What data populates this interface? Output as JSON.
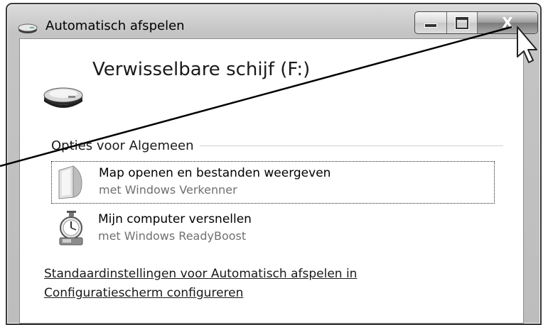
{
  "window": {
    "title": "Automatisch afspelen",
    "close_label": "X"
  },
  "device": {
    "title": "Verwisselbare schijf (F:)"
  },
  "section": {
    "header": "Opties voor Algemeen"
  },
  "options": [
    {
      "label": "Map openen en bestanden weergeven",
      "sub": "met Windows Verkenner",
      "icon": "folder-icon",
      "selected": true
    },
    {
      "label": "Mijn computer versnellen",
      "sub": "met Windows ReadyBoost",
      "icon": "stopwatch-icon",
      "selected": false
    }
  ],
  "footer": {
    "link_line1": "Standaardinstellingen voor Automatisch afspelen in",
    "link_line2": "Configuratiescherm configureren"
  },
  "icons": {
    "title": "drive-icon",
    "device": "removable-drive-icon",
    "pointer": "mouse-cursor-icon"
  },
  "colors": {
    "frame": "#c8c8c8",
    "content_bg": "#ffffff",
    "subtext": "#707070",
    "close_button": "#8a8a8a"
  }
}
